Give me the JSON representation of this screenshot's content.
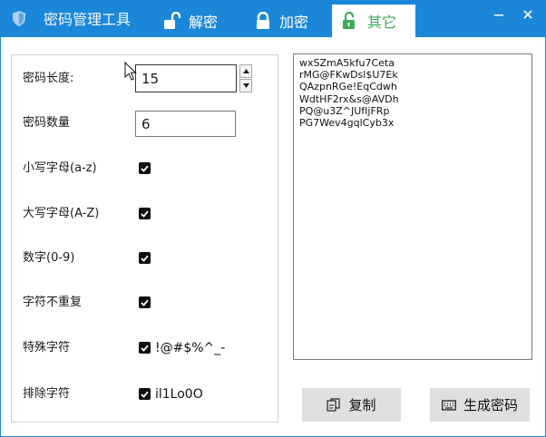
{
  "app": {
    "title": "密码管理工具",
    "icon": "shield-icon"
  },
  "tabs": [
    {
      "label": "解密",
      "icon": "unlock-icon"
    },
    {
      "label": "加密",
      "icon": "lock-icon"
    },
    {
      "label": "其它",
      "icon": "unlock-icon"
    }
  ],
  "window_controls": {
    "minimize": "minimize-icon",
    "close": "close-icon"
  },
  "options": {
    "length": {
      "label": "密码长度:",
      "value": "15"
    },
    "count": {
      "label": "密码数量",
      "value": "6"
    },
    "lowercase": {
      "label": "小写字母(a-z)",
      "checked": true
    },
    "uppercase": {
      "label": "大写字母(A-Z)",
      "checked": true
    },
    "digits": {
      "label": "数字(0-9)",
      "checked": true
    },
    "no_repeat": {
      "label": "字符不重复",
      "checked": true
    },
    "special": {
      "label": "特殊字符",
      "checked": true,
      "chars": "!@#$%^_-"
    },
    "exclude": {
      "label": "排除字符",
      "checked": true,
      "chars": "il1Lo0O"
    }
  },
  "output": {
    "passwords": [
      "wxSZmA5kfu7Ceta",
      "rMG@FKwDsl$U7Ek",
      "QAzpnRGe!EqCdwh",
      "WdtHF2rx&s@AVDh",
      "PQ@u3Z^JUfIjFRp",
      "PG7Wev4gqlCyb3x"
    ]
  },
  "buttons": {
    "copy": {
      "label": "复制",
      "icon": "copy-icon"
    },
    "generate": {
      "label": "生成密码",
      "icon": "keyboard-icon"
    }
  },
  "colors": {
    "titlebar": "#1b87d8",
    "active_tab_text": "#3daa58",
    "button_bg": "#dfdfdf"
  }
}
